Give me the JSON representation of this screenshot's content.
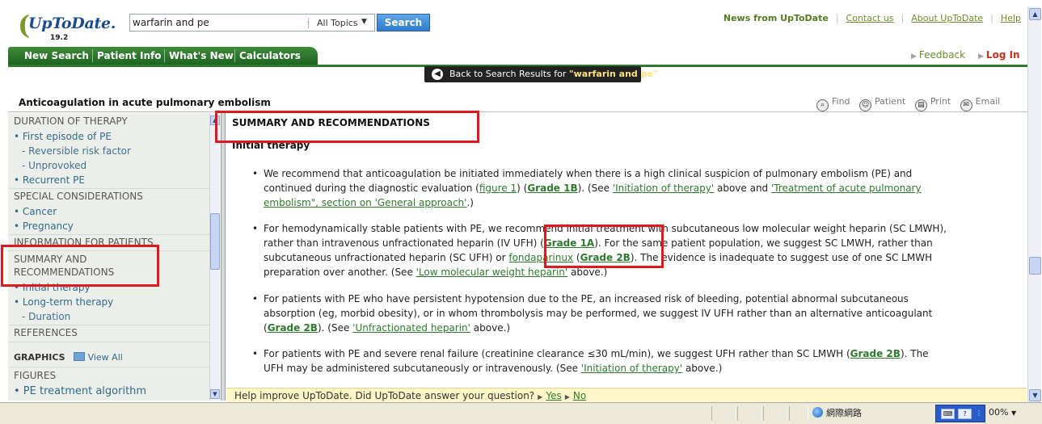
{
  "app": {
    "brand": "UpToDate.",
    "version": "19.2",
    "colors": {
      "brand_blue": "#1a4b8c",
      "nav_green": "#2f7a2c",
      "link_green": "#2e7a2c",
      "login_red": "#c4321f",
      "annotation_red": "#e0191f"
    }
  },
  "search": {
    "query": "warfarin and pe",
    "scope": "All Topics",
    "button": "Search"
  },
  "toplinks": [
    "News from UpToDate",
    "Contact us",
    "About UpToDate",
    "Help"
  ],
  "nav": [
    "New Search",
    "Patient Info",
    "What's New",
    "Calculators"
  ],
  "feedback": "Feedback",
  "login": "Log In",
  "back_bar": {
    "prefix": "Back to Search Results for ",
    "query": "\"warfarin and pe\""
  },
  "topic_title": "Anticoagulation in acute pulmonary embolism",
  "tools": [
    "Find",
    "Patient",
    "Print",
    "Email"
  ],
  "sidebar": {
    "items": [
      {
        "text": "DURATION OF THERAPY",
        "kind": "section"
      },
      {
        "text": "• First episode of PE",
        "kind": "bullet"
      },
      {
        "text": "- Reversible risk factor",
        "kind": "sub"
      },
      {
        "text": "- Unprovoked",
        "kind": "sub"
      },
      {
        "text": "• Recurrent PE",
        "kind": "bullet"
      },
      {
        "text": "SPECIAL CONSIDERATIONS",
        "kind": "section"
      },
      {
        "text": "• Cancer",
        "kind": "bullet"
      },
      {
        "text": "• Pregnancy",
        "kind": "bullet"
      },
      {
        "text": "INFORMATION FOR PATIENTS",
        "kind": "section"
      },
      {
        "text": "SUMMARY AND",
        "kind": "section"
      },
      {
        "text": "RECOMMENDATIONS",
        "kind": "section"
      },
      {
        "text": "• Initial therapy",
        "kind": "bullet"
      },
      {
        "text": "• Long-term therapy",
        "kind": "bullet"
      },
      {
        "text": "- Duration",
        "kind": "sub"
      },
      {
        "text": "REFERENCES",
        "kind": "section"
      }
    ],
    "graphics_label": "GRAPHICS",
    "view_all": "View All",
    "figures_label": "FIGURES",
    "figure_item": "• PE treatment algorithm"
  },
  "content": {
    "section_heading": "SUMMARY AND RECOMMENDATIONS",
    "subheading": "Initial therapy",
    "bullets": [
      {
        "lines": [
          [
            {
              "t": "We recommend that anticoagulation be initiated immediately when there is a high clinical suspicion of pulmonary embolism (PE) and"
            }
          ],
          [
            {
              "t": "continued during the diagnostic evaluation ("
            },
            {
              "t": "figure 1",
              "s": "link"
            },
            {
              "t": ") ("
            },
            {
              "t": "Grade 1B",
              "s": "grade"
            },
            {
              "t": "). (See "
            },
            {
              "t": "'Initiation of therapy'",
              "s": "link"
            },
            {
              "t": " above and "
            },
            {
              "t": "'Treatment of acute pulmonary",
              "s": "link"
            }
          ],
          [
            {
              "t": "embolism\", section on 'General approach'",
              "s": "link"
            },
            {
              "t": ".)"
            }
          ]
        ]
      },
      {
        "lines": [
          [
            {
              "t": "For hemodynamically stable patients with PE, we recommend initial treatment with subcutaneous low molecular weight heparin (SC LMWH),"
            }
          ],
          [
            {
              "t": "rather than intravenous unfractionated heparin (IV UFH) ("
            },
            {
              "t": "Grade 1A",
              "s": "grade"
            },
            {
              "t": "). For the same patient population, we suggest SC LMWH, rather than"
            }
          ],
          [
            {
              "t": "subcutaneous unfractionated heparin (SC UFH) or "
            },
            {
              "t": "fondaparinux",
              "s": "link"
            },
            {
              "t": " ("
            },
            {
              "t": "Grade 2B",
              "s": "grade"
            },
            {
              "t": "). The evidence is inadequate to suggest use of one SC LMWH"
            }
          ],
          [
            {
              "t": "preparation over another. (See "
            },
            {
              "t": "'Low molecular weight heparin'",
              "s": "link"
            },
            {
              "t": " above.)"
            }
          ]
        ]
      },
      {
        "lines": [
          [
            {
              "t": "For patients with PE who have persistent hypotension due to the PE, an increased risk of bleeding, potential abnormal subcutaneous"
            }
          ],
          [
            {
              "t": "absorption (eg, morbid obesity), or in whom thrombolysis may be performed, we suggest IV UFH rather than an alternative anticoagulant"
            }
          ],
          [
            {
              "t": "("
            },
            {
              "t": "Grade 2B",
              "s": "grade"
            },
            {
              "t": "). (See "
            },
            {
              "t": "'Unfractionated heparin'",
              "s": "link"
            },
            {
              "t": " above.)"
            }
          ]
        ]
      },
      {
        "lines": [
          [
            {
              "t": "For patients with PE and severe renal failure (creatinine clearance ≤30 mL/min), we suggest UFH rather than SC LMWH ("
            },
            {
              "t": "Grade 2B",
              "s": "grade"
            },
            {
              "t": "). The"
            }
          ],
          [
            {
              "t": "UFH may be administered subcutaneously or intravenously. (See "
            },
            {
              "t": "'Initiation of therapy'",
              "s": "link"
            },
            {
              "t": " above.)"
            }
          ]
        ]
      }
    ]
  },
  "helpbar": {
    "question": "Help improve UpToDate. Did UpToDate answer your question?",
    "yes": "Yes",
    "no": "No"
  },
  "statusbar": {
    "zone": "網際網路",
    "zoom": "00%"
  }
}
